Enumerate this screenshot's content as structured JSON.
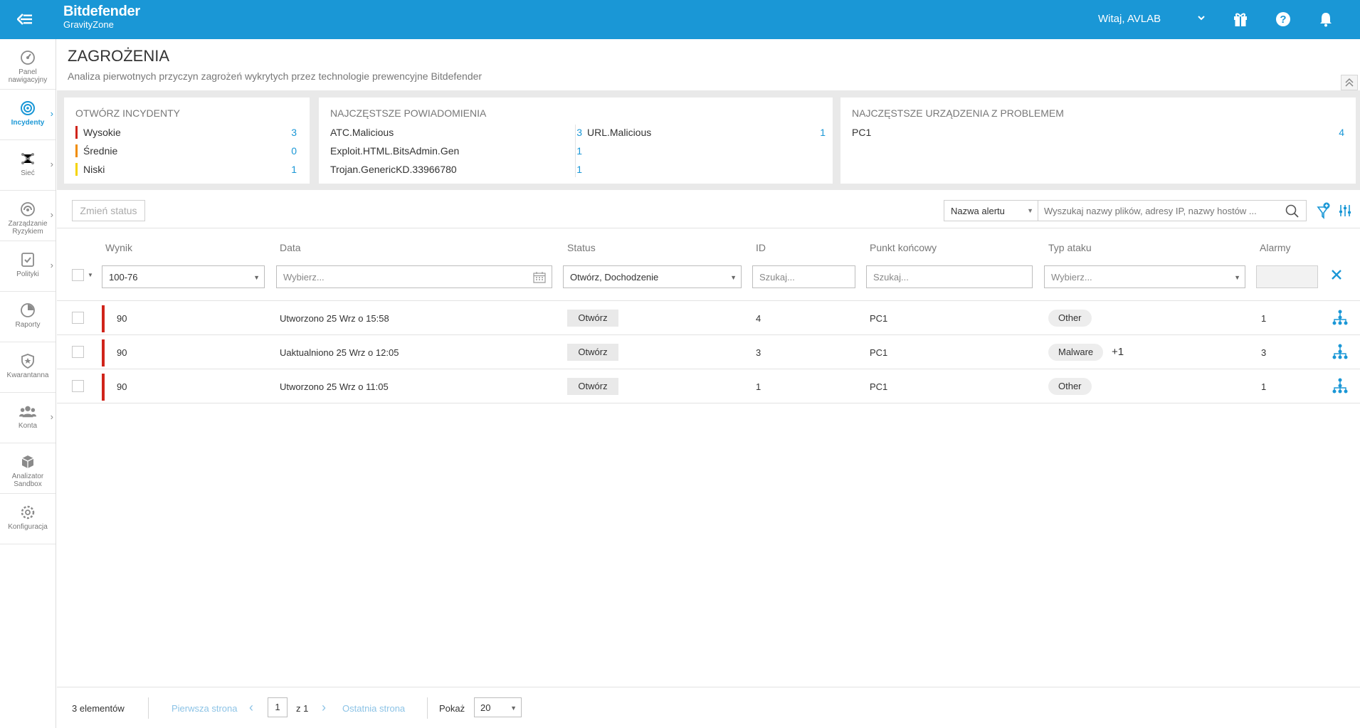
{
  "header": {
    "brand_name": "Bitdefender",
    "brand_product": "GravityZone",
    "greeting": "Witaj, AVLAB"
  },
  "sidebar": {
    "items": [
      {
        "label": "Panel nawigacyjny",
        "icon": "dashboard-icon",
        "active": false,
        "has_arrow": false
      },
      {
        "label": "Incydenty",
        "icon": "incidents-icon",
        "active": true,
        "has_arrow": true
      },
      {
        "label": "Sieć",
        "icon": "network-icon",
        "active": false,
        "has_arrow": true
      },
      {
        "label": "Zarządzanie Ryzykiem",
        "icon": "risk-management-icon",
        "active": false,
        "has_arrow": true
      },
      {
        "label": "Polityki",
        "icon": "policies-icon",
        "active": false,
        "has_arrow": true
      },
      {
        "label": "Raporty",
        "icon": "reports-icon",
        "active": false,
        "has_arrow": false
      },
      {
        "label": "Kwarantanna",
        "icon": "quarantine-icon",
        "active": false,
        "has_arrow": false
      },
      {
        "label": "Konta",
        "icon": "accounts-icon",
        "active": false,
        "has_arrow": true
      },
      {
        "label": "Analizator Sandbox",
        "icon": "sandbox-icon",
        "active": false,
        "has_arrow": false
      },
      {
        "label": "Konfiguracja",
        "icon": "configuration-icon",
        "active": false,
        "has_arrow": false
      }
    ]
  },
  "page": {
    "title": "ZAGROŻENIA",
    "subtitle": "Analiza pierwotnych przyczyn zagrożeń wykrytych przez technologie prewencyjne Bitdefender"
  },
  "cards": {
    "open_incidents": {
      "title": "OTWÓRZ INCYDENTY",
      "rows": [
        {
          "label": "Wysokie",
          "count": "3",
          "color": "#d0241b"
        },
        {
          "label": "Średnie",
          "count": "0",
          "color": "#f08c00"
        },
        {
          "label": "Niski",
          "count": "1",
          "color": "#f5d300"
        }
      ]
    },
    "top_alerts": {
      "title": "NAJCZĘSTSZE POWIADOMIENIA",
      "left": [
        {
          "label": "ATC.Malicious",
          "count": "3"
        },
        {
          "label": "Exploit.HTML.BitsAdmin.Gen",
          "count": "1"
        },
        {
          "label": "Trojan.GenericKD.33966780",
          "count": "1"
        }
      ],
      "right": [
        {
          "label": "URL.Malicious",
          "count": "1"
        }
      ]
    },
    "top_devices": {
      "title": "NAJCZĘSTSZE URZĄDZENIA Z PROBLEMEM",
      "rows": [
        {
          "label": "PC1",
          "count": "4"
        }
      ]
    }
  },
  "toolbar": {
    "change_status": "Zmień status",
    "alert_field": "Nazwa alertu",
    "search_placeholder": "Wyszukaj nazwy plików, adresy IP, nazwy hostów ..."
  },
  "table": {
    "headers": {
      "score": "Wynik",
      "date": "Data",
      "status": "Status",
      "id": "ID",
      "endpoint": "Punkt końcowy",
      "attack_type": "Typ ataku",
      "alarms": "Alarmy"
    },
    "filters": {
      "score": "100-76",
      "date": "Wybierz...",
      "status": "Otwórz, Dochodzenie",
      "id": "Szukaj...",
      "endpoint": "Szukaj...",
      "attack_type": "Wybierz..."
    },
    "rows": [
      {
        "score": "90",
        "date": "Utworzono 25 Wrz o 15:58",
        "status": "Otwórz",
        "id": "4",
        "endpoint": "PC1",
        "attack_type": "Other",
        "extra": "",
        "alarms": "1"
      },
      {
        "score": "90",
        "date": "Uaktualniono 25 Wrz o 12:05",
        "status": "Otwórz",
        "id": "3",
        "endpoint": "PC1",
        "attack_type": "Malware",
        "extra": "+1",
        "alarms": "3"
      },
      {
        "score": "90",
        "date": "Utworzono 25 Wrz o 11:05",
        "status": "Otwórz",
        "id": "1",
        "endpoint": "PC1",
        "attack_type": "Other",
        "extra": "",
        "alarms": "1"
      }
    ]
  },
  "footer": {
    "count": "3 elementów",
    "first_page": "Pierwsza strona",
    "page": "1",
    "of_pages": "z 1",
    "last_page": "Ostatnia strona",
    "show_label": "Pokaż",
    "page_size": "20"
  },
  "colors": {
    "brand_blue": "#1a97d6",
    "severity_high": "#d0241b",
    "severity_medium": "#f08c00",
    "severity_low": "#f5d300"
  }
}
